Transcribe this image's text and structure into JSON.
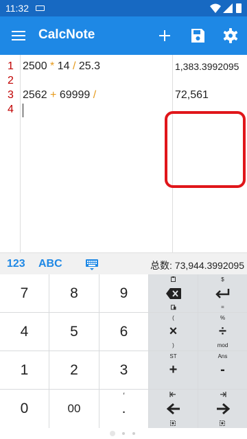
{
  "status": {
    "time": "11:32"
  },
  "app": {
    "title": "CalcNote"
  },
  "editor": {
    "line_numbers": [
      "1",
      "2",
      "3",
      "4"
    ],
    "lines": [
      {
        "a": "2500 ",
        "op1": "*",
        "b": " 14 ",
        "op2": "/",
        "c": " 25.3"
      },
      {
        "a": "",
        "op1": "",
        "b": "",
        "op2": "",
        "c": ""
      },
      {
        "a": "2562 ",
        "op1": "+",
        "b": " 69999 ",
        "op2": "/",
        "c": ""
      },
      {
        "a": "",
        "op1": "",
        "b": "",
        "op2": "",
        "c": ""
      }
    ],
    "results": [
      "1,383.3992095",
      "",
      "72,561",
      ""
    ]
  },
  "keyboard": {
    "tab_numeric": "123",
    "tab_alpha": "ABC",
    "total": "总数: 73,944.3992095",
    "keys": {
      "k7": "7",
      "k8": "8",
      "k9": "9",
      "k4": "4",
      "k5": "5",
      "k6": "6",
      "k1": "1",
      "k2": "2",
      "k3": "3",
      "k0": "0",
      "k00": "00",
      "kdot": ".",
      "kdot_sup": "′",
      "backspace_sub": "",
      "enter_sup": "$",
      "enter_sub": "=",
      "mul": "×",
      "mul_sup": "(",
      "mul_sub": ")",
      "div": "÷",
      "div_sup": "%",
      "div_sub": "mod",
      "plus": "+",
      "plus_sup": "ST",
      "minus": "-",
      "minus_sup": "Ans"
    }
  },
  "colors": {
    "primary": "#1e88e5",
    "status_bar": "#1769c2",
    "line_number": "#c00000",
    "operator": "#e69a1c",
    "highlight": "#e0161a"
  }
}
